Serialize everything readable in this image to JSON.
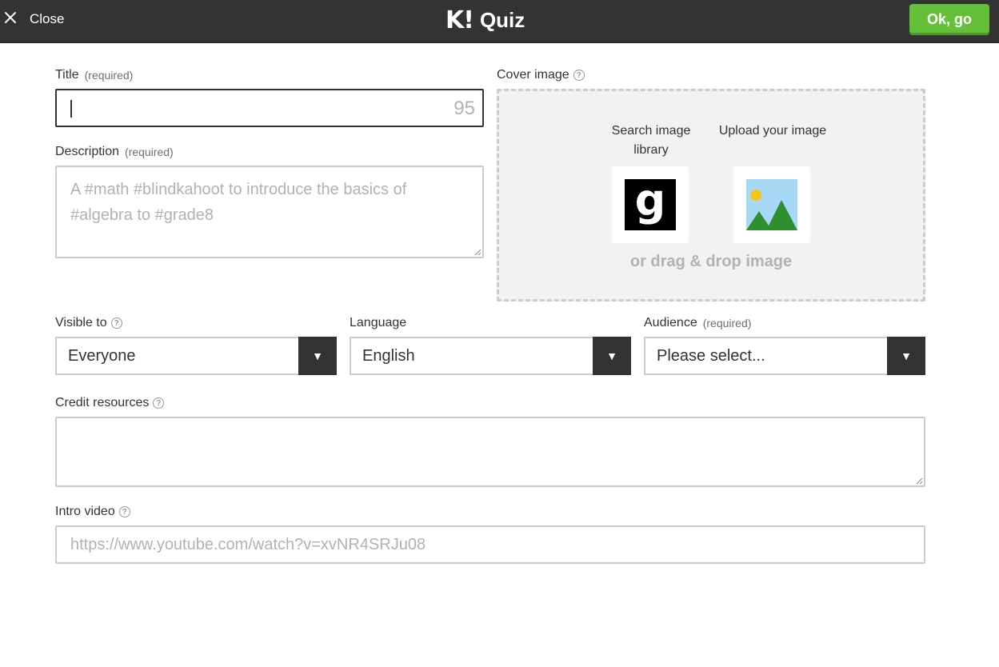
{
  "topbar": {
    "close_label": "Close",
    "brand_mark": "K!",
    "brand_title": "Quiz",
    "ok_label": "Ok, go"
  },
  "title_field": {
    "label": "Title",
    "required_label": "(required)",
    "value": "",
    "char_count": "95"
  },
  "description_field": {
    "label": "Description",
    "required_label": "(required)",
    "placeholder": "A #math #blindkahoot to introduce the basics of #algebra to #grade8"
  },
  "cover_image": {
    "label": "Cover image",
    "search_label": "Search image library",
    "search_icon": "g",
    "upload_label": "Upload your image",
    "drag_drop_text": "or drag & drop image"
  },
  "visible_to": {
    "label": "Visible to",
    "value": "Everyone"
  },
  "language": {
    "label": "Language",
    "value": "English"
  },
  "audience": {
    "label": "Audience",
    "required_label": "(required)",
    "value": "Please select..."
  },
  "credit_resources": {
    "label": "Credit resources",
    "value": ""
  },
  "intro_video": {
    "label": "Intro video",
    "placeholder": "https://www.youtube.com/watch?v=xvNR4SRJu08"
  },
  "colors": {
    "topbar": "#333333",
    "ok_button": "#66bf39",
    "placeholder": "#b2b2b2",
    "border": "#cccccc"
  }
}
